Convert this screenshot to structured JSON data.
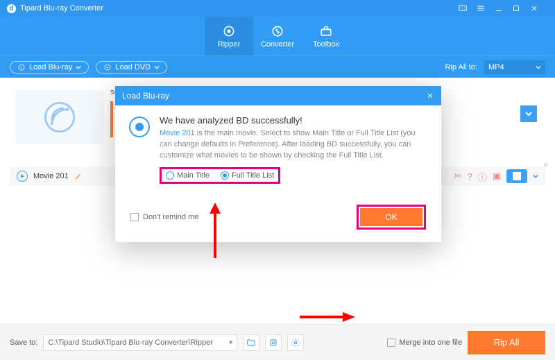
{
  "titlebar": {
    "app_name": "Tipard Blu-ray Converter"
  },
  "nav": {
    "items": [
      {
        "label": "Ripper"
      },
      {
        "label": "Converter"
      },
      {
        "label": "Toolbox"
      }
    ]
  },
  "secbar": {
    "load_bluray": "Load Blu-ray",
    "load_dvd": "Load DVD",
    "rip_all_label": "Rip All to:",
    "rip_all_value": "MP4"
  },
  "content": {
    "scenery_label": "scenery",
    "movie_name": "Movie 201"
  },
  "modal": {
    "title": "Load Blu-ray",
    "heading": "We have analyzed BD successfully!",
    "movie_ref": "Movie 201",
    "desc_after_movie": " is the main movie. Select to show Main Title or Full Title List (you can change defaults in Preference). After loading BD successfully, you can customize what movies to be shown by checking the Full Title List.",
    "opt_main": "Main Title",
    "opt_full": "Full Title List",
    "dont_remind": "Don't remind me",
    "ok": "OK"
  },
  "bottom": {
    "save_to_label": "Save to:",
    "path": "C:\\Tipard Studio\\Tipard Blu-ray Converter\\Ripper",
    "merge_label": "Merge into one file",
    "rip_all": "Rip All"
  }
}
